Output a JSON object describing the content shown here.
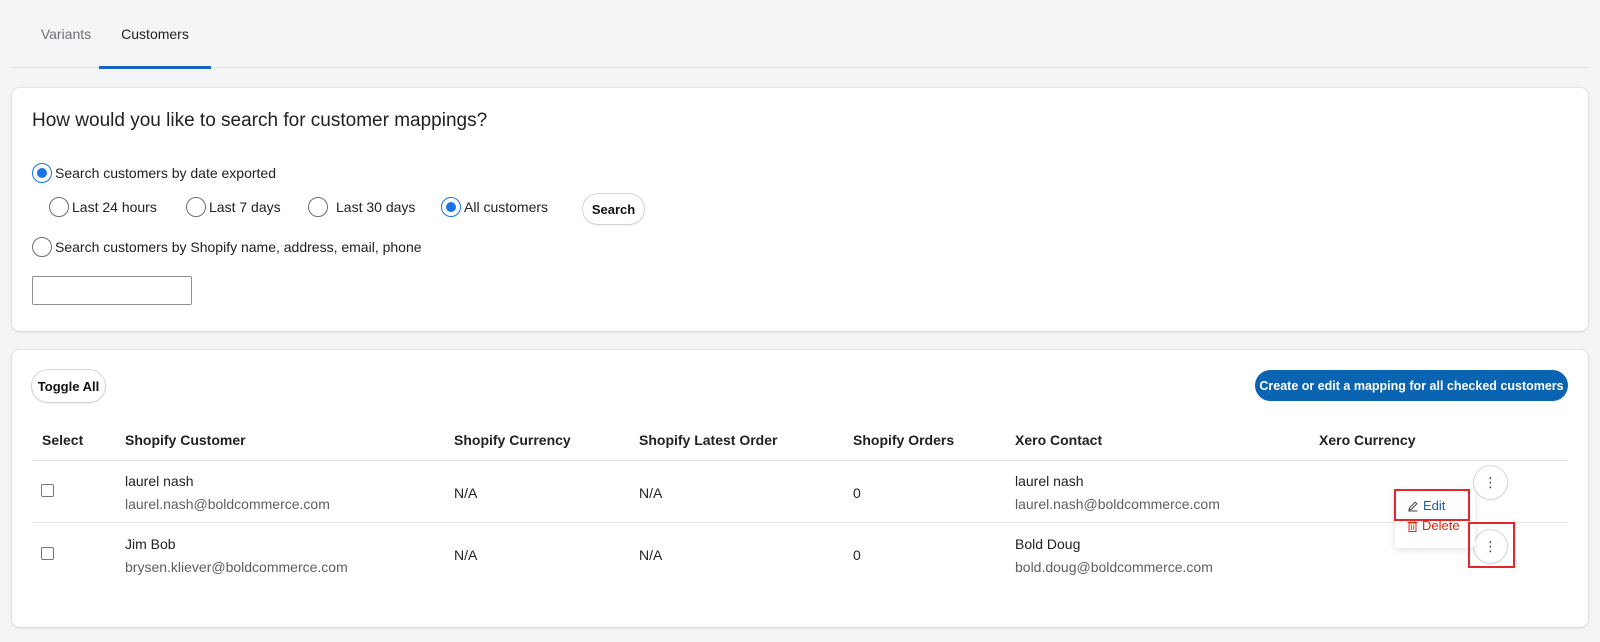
{
  "tabs": [
    {
      "label": "Variants",
      "active": false
    },
    {
      "label": "Customers",
      "active": true
    }
  ],
  "search_card": {
    "title": "How would you like to search for customer mappings?",
    "option_date": "Search customers by date exported",
    "date_ranges": [
      "Last 24 hours",
      "Last 7 days",
      "Last 30 days",
      "All customers"
    ],
    "selected_range": "All customers",
    "search_button": "Search",
    "option_shopify": "Search customers by Shopify name, address, email, phone",
    "search_value": ""
  },
  "results_card": {
    "toggle_all": "Toggle All",
    "bulk_action": "Create or edit a mapping for all checked customers",
    "columns": [
      "Select",
      "Shopify Customer",
      "Shopify Currency",
      "Shopify Latest Order",
      "Shopify Orders",
      "Xero Contact",
      "Xero Currency"
    ],
    "rows": [
      {
        "customer_name": "laurel nash",
        "customer_email": "laurel.nash@boldcommerce.com",
        "currency": "N/A",
        "latest_order": "N/A",
        "orders": "0",
        "xero_name": "laurel nash",
        "xero_email": "laurel.nash@boldcommerce.com",
        "xero_currency": ""
      },
      {
        "customer_name": "Jim Bob",
        "customer_email": "brysen.kliever@boldcommerce.com",
        "currency": "N/A",
        "latest_order": "N/A",
        "orders": "0",
        "xero_name": "Bold Doug",
        "xero_email": "bold.doug@boldcommerce.com",
        "xero_currency": ""
      }
    ],
    "menu": {
      "edit": "Edit",
      "delete": "Delete"
    },
    "kebab_glyph": "⋮"
  },
  "colors": {
    "accent": "#0b64b1",
    "radio": "#1a73e8",
    "danger": "#d72c0d",
    "highlight": "#e5242b"
  }
}
